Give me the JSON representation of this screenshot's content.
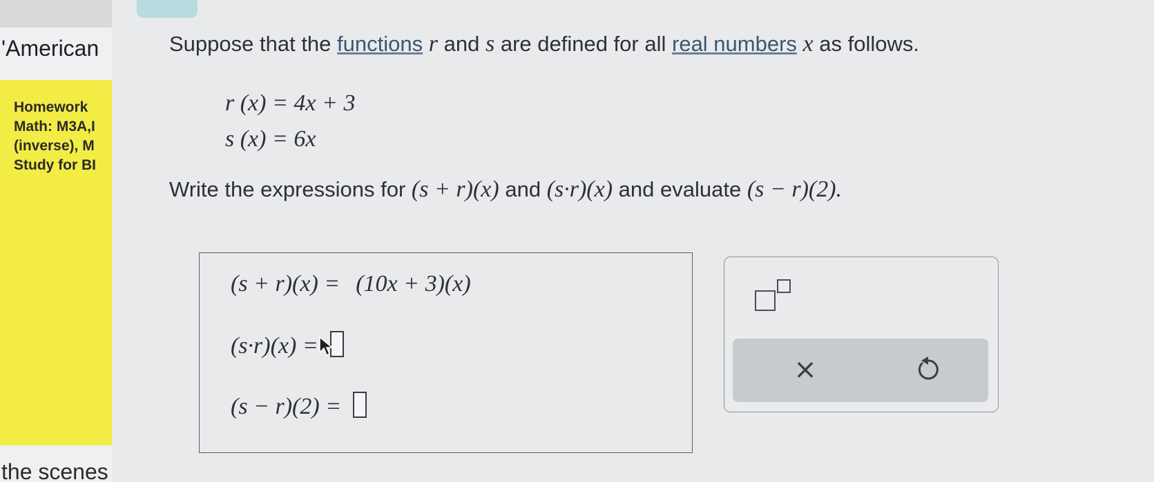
{
  "sidebar": {
    "title": "'American",
    "lines": [
      "Homework",
      "Math: M3A,I",
      "(inverse), M",
      "Study for BI"
    ],
    "bottom_text": "the scenes"
  },
  "question": {
    "intro_1": "Suppose that the",
    "link_functions": "functions",
    "var_r": "r",
    "and": "and",
    "var_s": "s",
    "intro_2": "are defined for all",
    "link_real_numbers": "real numbers",
    "var_x": "x",
    "intro_3": "as follows.",
    "def_r": "r (x) = 4x + 3",
    "def_s": "s (x) = 6x",
    "instruction_1": "Write the expressions for",
    "expr_sum": "(s + r)(x)",
    "instruction_and": "and",
    "expr_product": "(s·r)(x)",
    "instruction_evaluate": "and evaluate",
    "expr_diff": "(s − r)(2).",
    "final_period": ""
  },
  "answers": {
    "row1_lhs": "(s + r)(x)  =",
    "row1_value": "(10x + 3)(x)",
    "row2_lhs": "(s·r)(x)  =",
    "row3_lhs": "(s − r)(2)  ="
  },
  "tools": {
    "superscript_icon": "superscript-icon",
    "clear_symbol": "×",
    "undo_icon": "undo-icon"
  },
  "colors": {
    "sidebar_yellow": "#f3ec45",
    "link": "#3c5672",
    "toolbar_gray": "#c8cbce",
    "teal_button": "#b6dcdf"
  }
}
